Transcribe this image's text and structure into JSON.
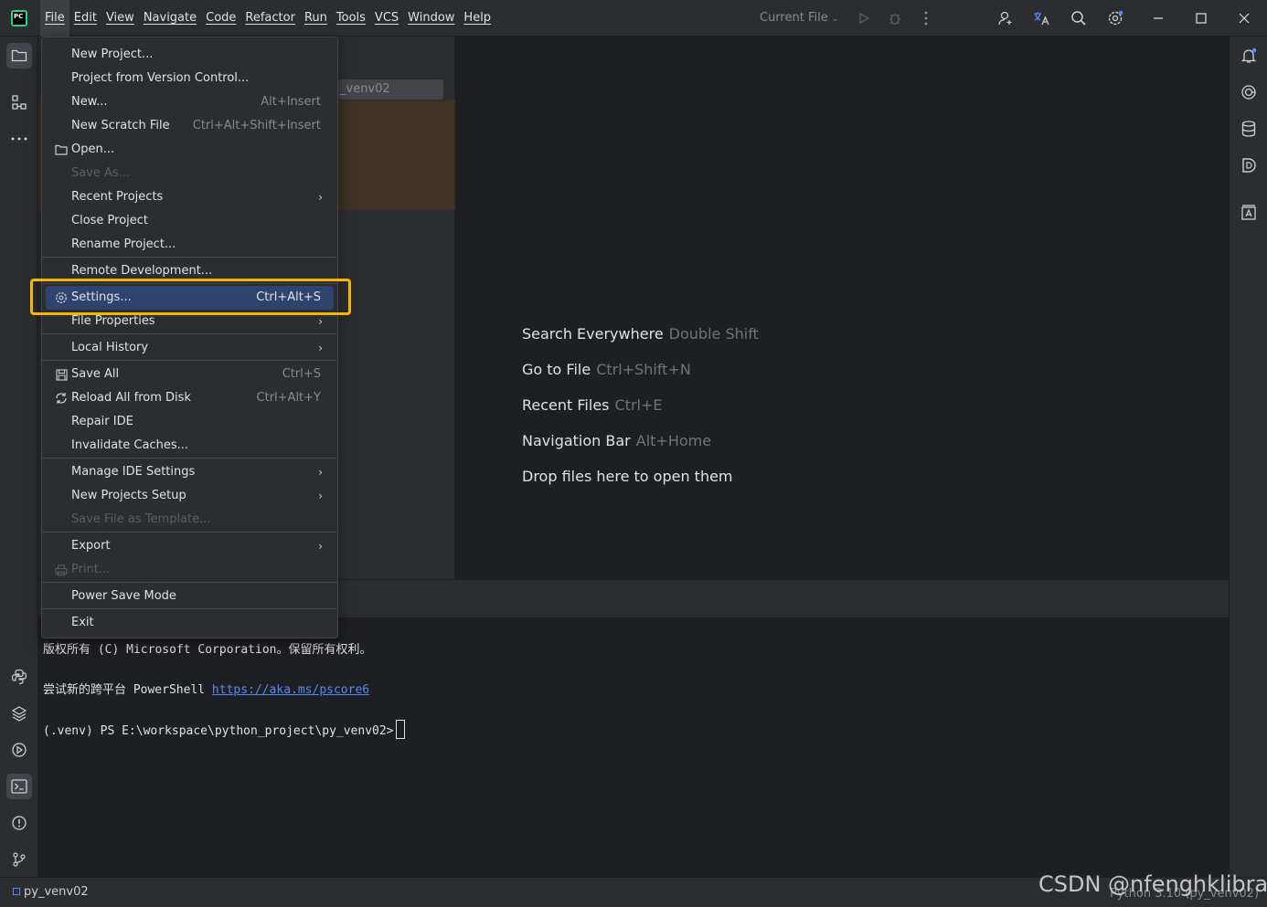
{
  "app": {
    "logo_text": "PC"
  },
  "menubar": [
    "File",
    "Edit",
    "View",
    "Navigate",
    "Code",
    "Refactor",
    "Run",
    "Tools",
    "VCS",
    "Window",
    "Help"
  ],
  "toolbar": {
    "run_config": "Current File",
    "icons": [
      "run-icon",
      "debug-icon",
      "more-vert-icon",
      "add-user-icon",
      "translate-icon",
      "search-icon",
      "settings-icon"
    ]
  },
  "window_controls": [
    "minimize-icon",
    "maximize-icon",
    "close-icon"
  ],
  "left_strip_icons": [
    "project-icon",
    "structure-icon",
    "more-horiz-icon",
    "python-console-icon",
    "python-packages-icon",
    "services-icon",
    "terminal-icon",
    "problems-icon",
    "git-icon"
  ],
  "right_strip_icons": [
    "notifications-icon",
    "ai-assistant-icon",
    "database-icon",
    "plugin-d-icon",
    "text-icon"
  ],
  "project_panel": {
    "row_text": "_venv02"
  },
  "file_menu": {
    "items": [
      {
        "label": "New Project...",
        "shortcut": "",
        "icon": "",
        "arrow": false,
        "disabled": false
      },
      {
        "label": "Project from Version Control...",
        "shortcut": "",
        "icon": "",
        "arrow": false,
        "disabled": false
      },
      {
        "label": "New...",
        "shortcut": "Alt+Insert",
        "icon": "",
        "arrow": false,
        "disabled": false
      },
      {
        "label": "New Scratch File",
        "shortcut": "Ctrl+Alt+Shift+Insert",
        "icon": "",
        "arrow": false,
        "disabled": false
      },
      {
        "label": "Open...",
        "shortcut": "",
        "icon": "folder-icon",
        "arrow": false,
        "disabled": false
      },
      {
        "label": "Save As...",
        "shortcut": "",
        "icon": "",
        "arrow": false,
        "disabled": true
      },
      {
        "label": "Recent Projects",
        "shortcut": "",
        "icon": "",
        "arrow": true,
        "disabled": false
      },
      {
        "label": "Close Project",
        "shortcut": "",
        "icon": "",
        "arrow": false,
        "disabled": false
      },
      {
        "label": "Rename Project...",
        "shortcut": "",
        "icon": "",
        "arrow": false,
        "disabled": false
      },
      {
        "label": "Remote Development...",
        "shortcut": "",
        "icon": "",
        "arrow": false,
        "disabled": false
      },
      {
        "label": "Settings...",
        "shortcut": "Ctrl+Alt+S",
        "icon": "gear-icon",
        "arrow": false,
        "disabled": false,
        "selected": true
      },
      {
        "label": "File Properties",
        "shortcut": "",
        "icon": "",
        "arrow": true,
        "disabled": false
      },
      {
        "label": "Local History",
        "shortcut": "",
        "icon": "",
        "arrow": true,
        "disabled": false
      },
      {
        "label": "Save All",
        "shortcut": "Ctrl+S",
        "icon": "save-icon",
        "arrow": false,
        "disabled": false
      },
      {
        "label": "Reload All from Disk",
        "shortcut": "Ctrl+Alt+Y",
        "icon": "reload-icon",
        "arrow": false,
        "disabled": false
      },
      {
        "label": "Repair IDE",
        "shortcut": "",
        "icon": "",
        "arrow": false,
        "disabled": false
      },
      {
        "label": "Invalidate Caches...",
        "shortcut": "",
        "icon": "",
        "arrow": false,
        "disabled": false
      },
      {
        "label": "Manage IDE Settings",
        "shortcut": "",
        "icon": "",
        "arrow": true,
        "disabled": false
      },
      {
        "label": "New Projects Setup",
        "shortcut": "",
        "icon": "",
        "arrow": true,
        "disabled": false
      },
      {
        "label": "Save File as Template...",
        "shortcut": "",
        "icon": "",
        "arrow": false,
        "disabled": true
      },
      {
        "label": "Export",
        "shortcut": "",
        "icon": "",
        "arrow": true,
        "disabled": false
      },
      {
        "label": "Print...",
        "shortcut": "",
        "icon": "print-icon",
        "arrow": false,
        "disabled": true
      },
      {
        "label": "Power Save Mode",
        "shortcut": "",
        "icon": "",
        "arrow": false,
        "disabled": false
      },
      {
        "label": "Exit",
        "shortcut": "",
        "icon": "",
        "arrow": false,
        "disabled": false
      }
    ]
  },
  "editor_hints": [
    {
      "action": "Search Everywhere",
      "key": "Double Shift"
    },
    {
      "action": "Go to File",
      "key": "Ctrl+Shift+N"
    },
    {
      "action": "Recent Files",
      "key": "Ctrl+E"
    },
    {
      "action": "Navigation Bar",
      "key": "Alt+Home"
    },
    {
      "action": "Drop files here to open them",
      "key": ""
    }
  ],
  "terminal": {
    "line1": "版权所有 (C) Microsoft Corporation。保留所有权利。",
    "line2_prefix": "尝试新的跨平台 PowerShell ",
    "line2_link": "https://aka.ms/pscore6",
    "line3": "(.venv) PS E:\\workspace\\python_project\\py_venv02>"
  },
  "statusbar": {
    "project": "py_venv02",
    "interpreter": "Python 3.10 (py_venv02)"
  },
  "watermark": "CSDN @nfenghklibra"
}
